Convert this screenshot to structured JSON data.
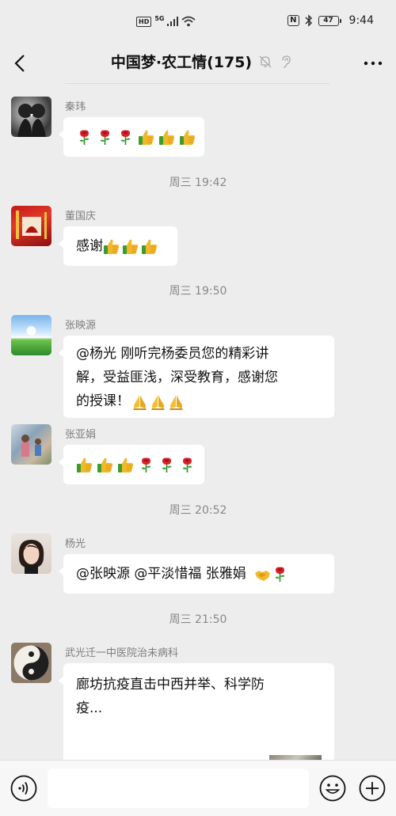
{
  "status_bar": {
    "hd": "HD",
    "network": "5G",
    "time": "9:44",
    "battery": "47"
  },
  "header": {
    "title": "中国梦·农工情(175)"
  },
  "messages": [
    {
      "sender": "秦玮",
      "emojis": [
        "rose-icon",
        "rose-icon",
        "rose-icon",
        "thumbs-up-icon",
        "thumbs-up-icon",
        "thumbs-up-icon"
      ]
    },
    {
      "timestamp": "周三 19:42"
    },
    {
      "sender": "董国庆",
      "text": "感谢",
      "emojis": [
        "thumbs-up-icon",
        "thumbs-up-icon",
        "thumbs-up-icon"
      ]
    },
    {
      "timestamp": "周三 19:50"
    },
    {
      "sender": "张映源",
      "lines": [
        "@杨光  刚听完杨委员您的精彩讲",
        "解，受益匪浅，深受教育，感谢您",
        "的授课！"
      ],
      "emojis": [
        "pray-icon",
        "pray-icon",
        "pray-icon"
      ]
    },
    {
      "sender": "张亚娟",
      "emojis": [
        "thumbs-up-icon",
        "thumbs-up-icon",
        "thumbs-up-icon",
        "rose-icon",
        "rose-icon",
        "rose-icon"
      ]
    },
    {
      "timestamp": "周三 20:52"
    },
    {
      "sender": "杨光",
      "text": "@张映源 @平淡惜福 张雅娟",
      "emojis": [
        "handshake-icon",
        "rose-icon"
      ]
    },
    {
      "timestamp": "周三 21:50"
    },
    {
      "sender": "武光迁一中医院治未病科",
      "lines": [
        "廊坊抗疫直击中西并举、科学防",
        "疫..."
      ]
    }
  ],
  "input": {
    "placeholder": ""
  }
}
